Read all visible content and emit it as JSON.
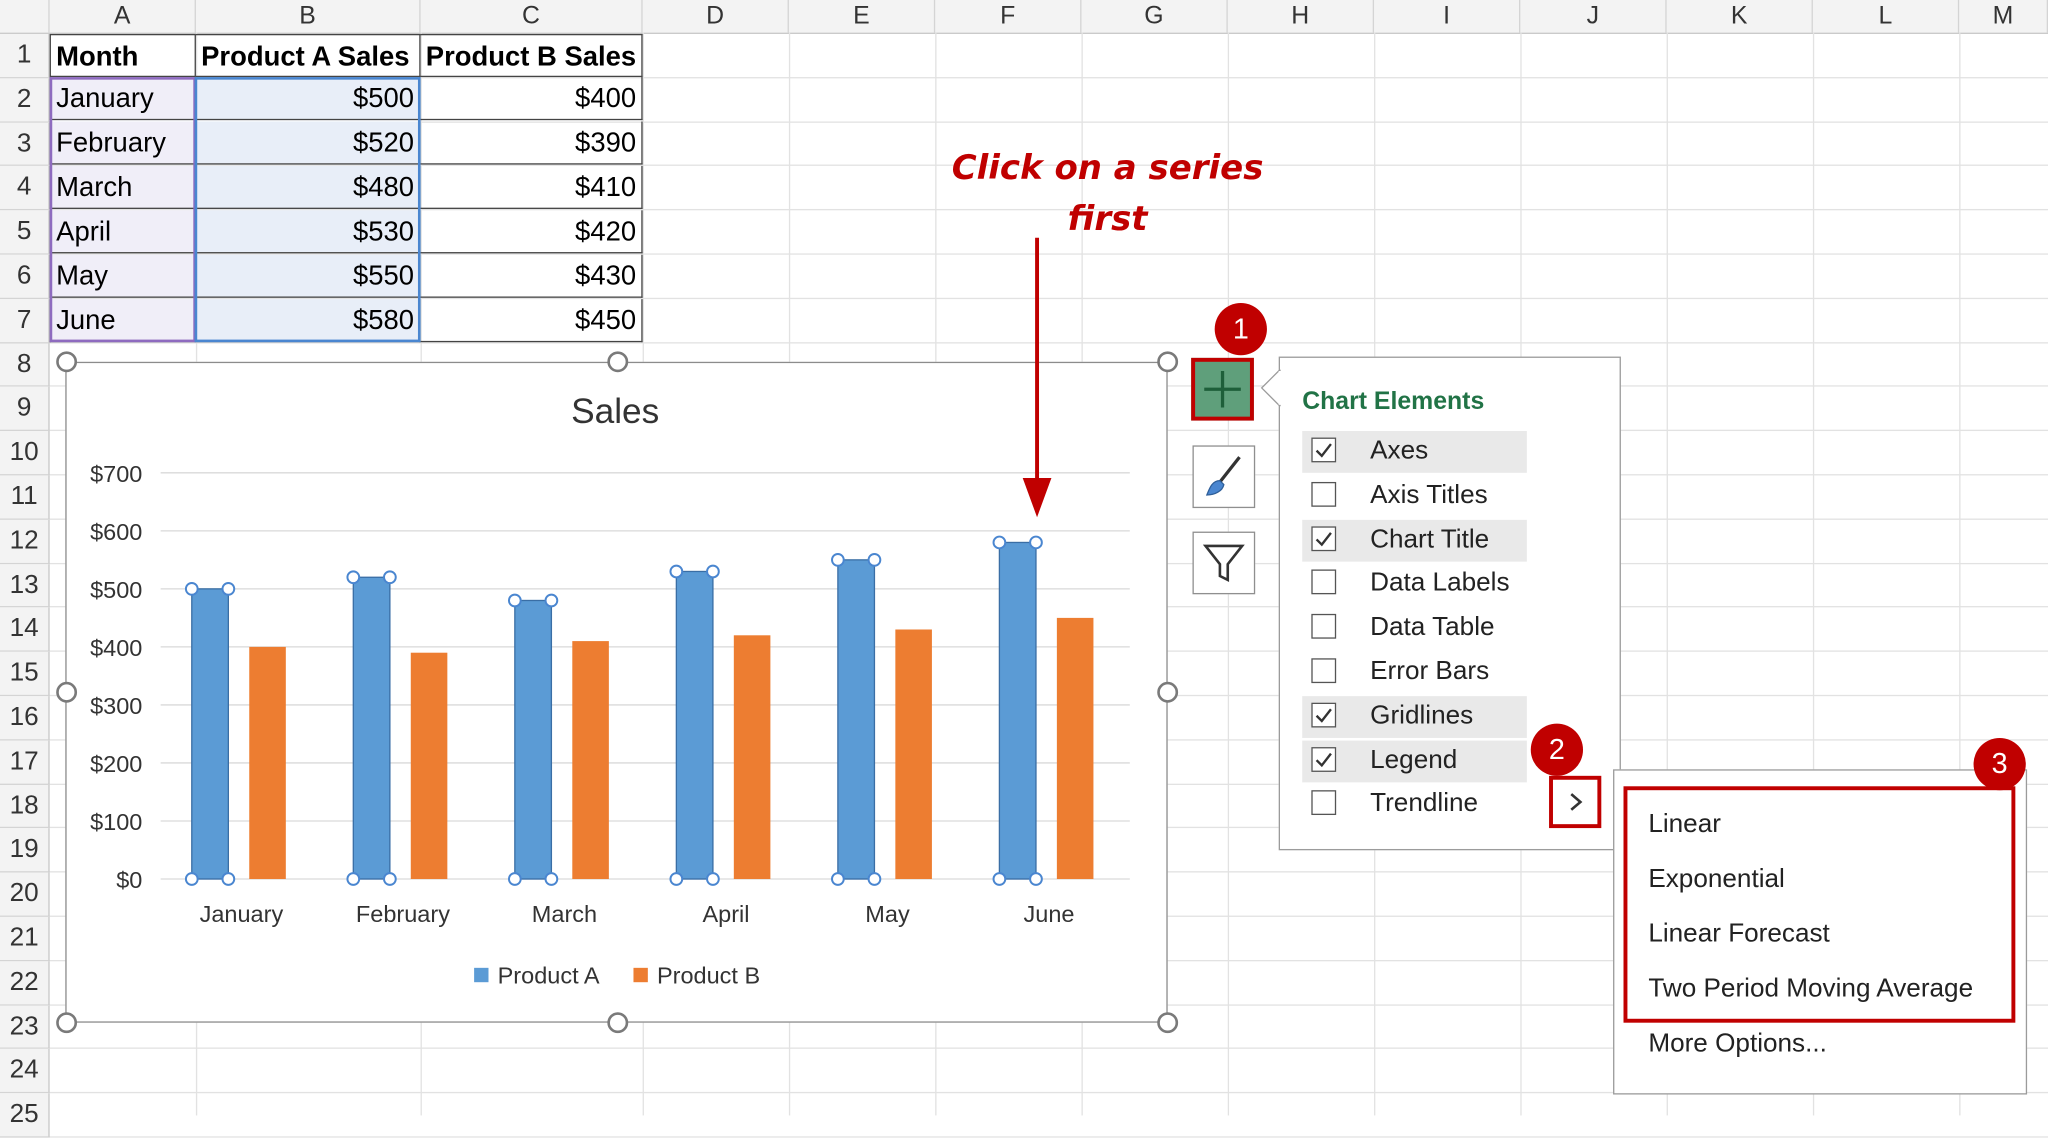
{
  "columns": [
    "A",
    "B",
    "C",
    "D",
    "E",
    "F",
    "G",
    "H",
    "I",
    "J",
    "K",
    "L",
    "M"
  ],
  "rows": [
    "1",
    "2",
    "3",
    "4",
    "5",
    "6",
    "7",
    "8",
    "9",
    "10",
    "11",
    "12",
    "13",
    "14",
    "15",
    "16",
    "17",
    "18",
    "19",
    "20",
    "21",
    "22",
    "23",
    "24",
    "25"
  ],
  "table": {
    "headers": [
      "Month",
      "Product A Sales",
      "Product B Sales"
    ],
    "rows": [
      {
        "month": "January",
        "a": "$500",
        "b": "$400"
      },
      {
        "month": "February",
        "a": "$520",
        "b": "$390"
      },
      {
        "month": "March",
        "a": "$480",
        "b": "$410"
      },
      {
        "month": "April",
        "a": "$530",
        "b": "$420"
      },
      {
        "month": "May",
        "a": "$550",
        "b": "$430"
      },
      {
        "month": "June",
        "a": "$580",
        "b": "$450"
      }
    ]
  },
  "chart_data": {
    "type": "bar",
    "title": "Sales",
    "categories": [
      "January",
      "February",
      "March",
      "April",
      "May",
      "June"
    ],
    "series": [
      {
        "name": "Product A",
        "values": [
          500,
          520,
          480,
          530,
          550,
          580
        ],
        "color": "#5b9bd5"
      },
      {
        "name": "Product B",
        "values": [
          400,
          390,
          410,
          420,
          430,
          450
        ],
        "color": "#ed7d31"
      }
    ],
    "ylim": [
      0,
      700
    ],
    "yticks": [
      0,
      100,
      200,
      300,
      400,
      500,
      600,
      700
    ],
    "ytick_labels": [
      "$0",
      "$100",
      "$200",
      "$300",
      "$400",
      "$500",
      "$600",
      "$700"
    ],
    "xlabel": "",
    "ylabel": "",
    "grid": true,
    "legend": "bottom",
    "selected_series": "Product A"
  },
  "annotation": {
    "line1": "Click on a series",
    "line2": "first"
  },
  "badges": {
    "one": "1",
    "two": "2",
    "three": "3"
  },
  "chart_elements": {
    "title": "Chart Elements",
    "items": [
      {
        "label": "Axes",
        "checked": true
      },
      {
        "label": "Axis Titles",
        "checked": false
      },
      {
        "label": "Chart Title",
        "checked": true
      },
      {
        "label": "Data Labels",
        "checked": false
      },
      {
        "label": "Data Table",
        "checked": false
      },
      {
        "label": "Error Bars",
        "checked": false
      },
      {
        "label": "Gridlines",
        "checked": true
      },
      {
        "label": "Legend",
        "checked": true
      },
      {
        "label": "Trendline",
        "checked": false
      }
    ]
  },
  "trendline_menu": {
    "items": [
      "Linear",
      "Exponential",
      "Linear Forecast",
      "Two Period Moving Average"
    ],
    "more": "More Options..."
  },
  "icons": {
    "plus": "plus-icon",
    "style": "paintbrush-icon",
    "filter": "filter-icon",
    "chevron": "chevron-right-icon"
  },
  "colors": {
    "accent_red": "#c00000",
    "excel_green": "#217346",
    "plus_bg": "#5f9f7b"
  }
}
